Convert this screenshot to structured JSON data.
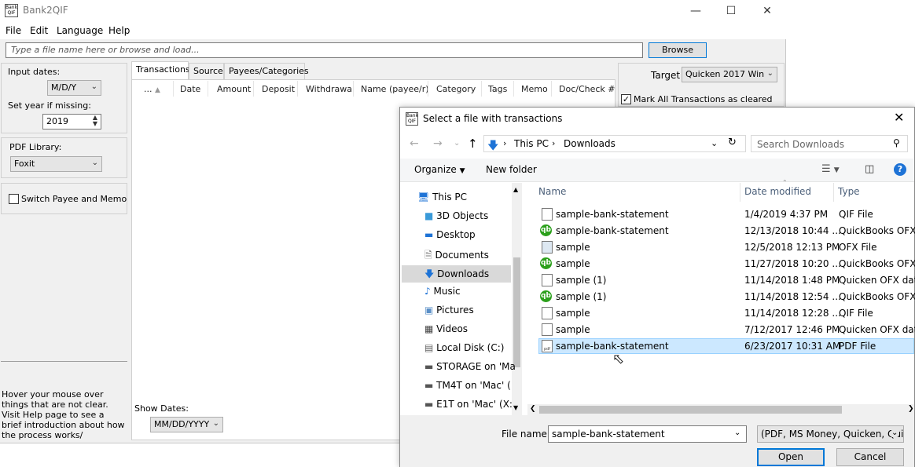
{
  "app": {
    "title": "Bank2QIF",
    "logo_text": "Bank QIF",
    "menu": [
      "File",
      "Edit",
      "Language",
      "Help"
    ],
    "file_placeholder": "Type a file name here or browse and load...",
    "browse_label": "Browse",
    "input_dates_label": "Input dates:",
    "input_dates_value": "M/D/Y",
    "set_year_label": "Set year if missing:",
    "year_value": "2019",
    "pdf_library_label": "PDF Library:",
    "pdf_library_value": "Foxit",
    "switch_label": "Switch Payee and Memo",
    "help_text": "Hover your mouse over things that are not clear. Visit Help page to see a brief introduction about how the process works/",
    "show_dates_label": "Show Dates:",
    "show_dates_value": "MM/DD/YYYY",
    "tabs": [
      "Transactions",
      "Source",
      "Payees/Categories"
    ],
    "columns": [
      "...",
      "Date",
      "Amount",
      "Deposit",
      "Withdrawal",
      "Name (payee/r)",
      "Category",
      "Tags",
      "Memo",
      "Doc/Check #"
    ],
    "target_label": "Target",
    "target_value": "Quicken 2017 Win",
    "mark_cleared_label": "Mark All Transactions as cleared"
  },
  "dialog": {
    "title": "Select a file with transactions",
    "breadcrumb": [
      "This PC",
      "Downloads"
    ],
    "search_placeholder": "Search Downloads",
    "organize_label": "Organize",
    "new_folder_label": "New folder",
    "tree": [
      {
        "label": "This PC",
        "icon": "computer-icon"
      },
      {
        "label": "3D Objects",
        "icon": "cube-icon"
      },
      {
        "label": "Desktop",
        "icon": "desktop-icon"
      },
      {
        "label": "Documents",
        "icon": "documents-icon"
      },
      {
        "label": "Downloads",
        "icon": "download-arrow-icon"
      },
      {
        "label": "Music",
        "icon": "music-icon"
      },
      {
        "label": "Pictures",
        "icon": "pictures-icon"
      },
      {
        "label": "Videos",
        "icon": "videos-icon"
      },
      {
        "label": "Local Disk (C:)",
        "icon": "disk-icon"
      },
      {
        "label": "STORAGE on 'Ma",
        "icon": "network-drive-icon"
      },
      {
        "label": "TM4T on 'Mac' (",
        "icon": "network-drive-icon"
      },
      {
        "label": "E1T on 'Mac' (X:",
        "icon": "network-drive-icon"
      }
    ],
    "columns": [
      "Name",
      "Date modified",
      "Type"
    ],
    "files": [
      {
        "name": "sample-bank-statement",
        "date": "1/4/2019 4:37 PM",
        "type": "QIF File",
        "icon": "doc"
      },
      {
        "name": "sample-bank-statement",
        "date": "12/13/2018 10:44 ...",
        "type": "QuickBooks OFX ...",
        "icon": "qb"
      },
      {
        "name": "sample",
        "date": "12/5/2018 12:13 PM",
        "type": "OFX File",
        "icon": "doc"
      },
      {
        "name": "sample",
        "date": "11/27/2018 10:20 ...",
        "type": "QuickBooks OFX ...",
        "icon": "qb"
      },
      {
        "name": "sample (1)",
        "date": "11/14/2018 1:48 PM",
        "type": "Quicken OFX data",
        "icon": "doc"
      },
      {
        "name": "sample (1)",
        "date": "11/14/2018 12:54 ...",
        "type": "QuickBooks OFX ...",
        "icon": "qb"
      },
      {
        "name": "sample",
        "date": "11/14/2018 12:28 ...",
        "type": "QIF File",
        "icon": "doc"
      },
      {
        "name": "sample",
        "date": "7/12/2017 12:46 PM",
        "type": "Quicken OFX data",
        "icon": "doc"
      },
      {
        "name": "sample-bank-statement",
        "date": "6/23/2017 10:31 AM",
        "type": "PDF File",
        "icon": "pdf"
      }
    ],
    "file_name_label": "File name:",
    "file_name_value": "sample-bank-statement",
    "filter_value": "(PDF, MS Money, Quicken, Qui",
    "open_label": "Open",
    "cancel_label": "Cancel"
  },
  "colors": {
    "selection": "#cce8ff",
    "accent": "#0078d7",
    "quickbooks": "#2ca01c"
  }
}
